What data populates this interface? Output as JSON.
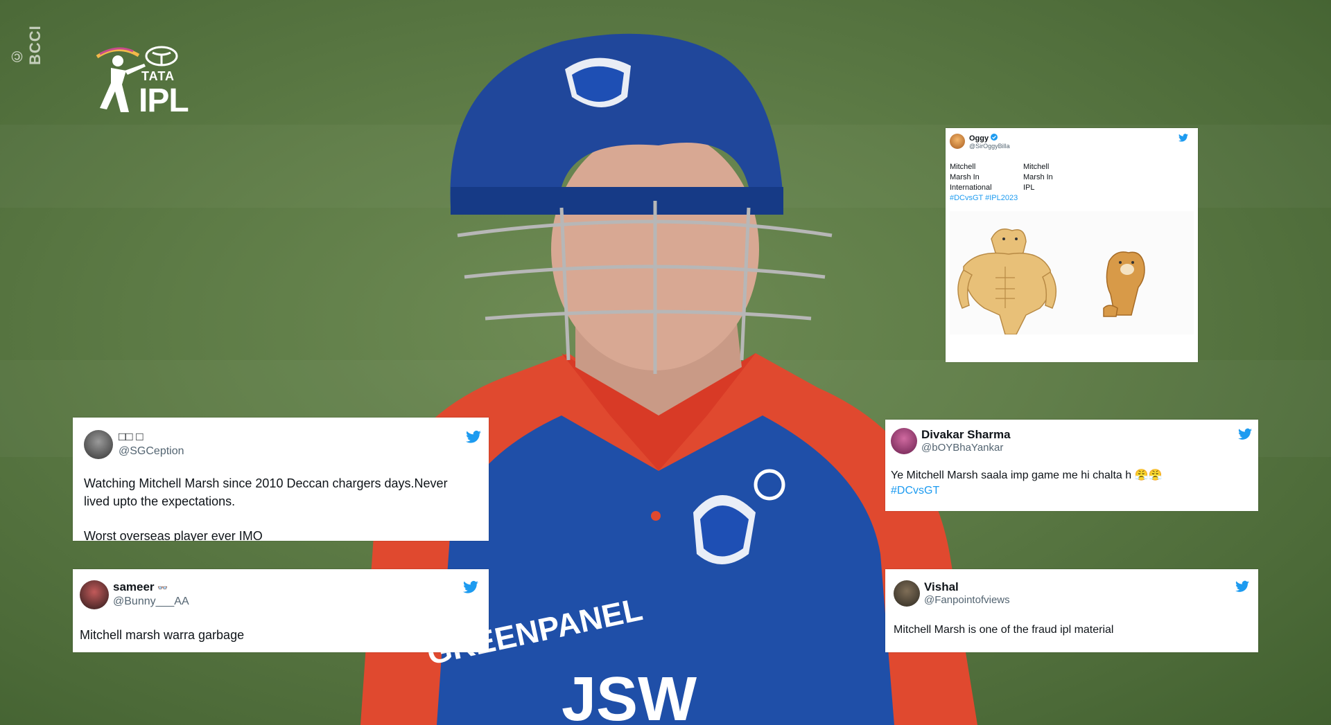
{
  "credit": "© BCCI",
  "logo": {
    "top": "TATA",
    "main": "IPL"
  },
  "tweets": {
    "sgception": {
      "name": "□□ □",
      "handle": "@SGCeption",
      "line1": "Watching Mitchell Marsh since 2010 Deccan chargers days.Never lived upto the expectations.",
      "line2": "Worst overseas player ever IMO"
    },
    "bunny": {
      "name": "sameer",
      "name_emoji": "👓",
      "handle": "@Bunny___AA",
      "text": "Mitchell marsh warra garbage"
    },
    "divakar": {
      "name": "Divakar Sharma",
      "handle": "@bOYBhaYankar",
      "text": "Ye Mitchell Marsh saala imp game me hi chalta h 😤😤",
      "tag": "#DCvsGT"
    },
    "vishal": {
      "name": "Vishal",
      "handle": "@Fanpointofviews",
      "text": "Mitchell Marsh is one of the fraud ipl material"
    },
    "oggy": {
      "name": "Oggy",
      "handle": "@SirOggyBilla",
      "col1": [
        "Mitchell",
        "Marsh In",
        "International"
      ],
      "col2": [
        "Mitchell",
        "Marsh In",
        "IPL"
      ],
      "tags": "#DCvsGT #IPL2023"
    }
  },
  "colors": {
    "twitter_blue": "#1d9bf0",
    "grass": "#5c7a45",
    "dc_blue": "#1e4fb4",
    "dc_red": "#e23b2a"
  },
  "icons": [
    "twitter-bird-icon",
    "verified-badge-icon",
    "ipl-logo-icon"
  ]
}
